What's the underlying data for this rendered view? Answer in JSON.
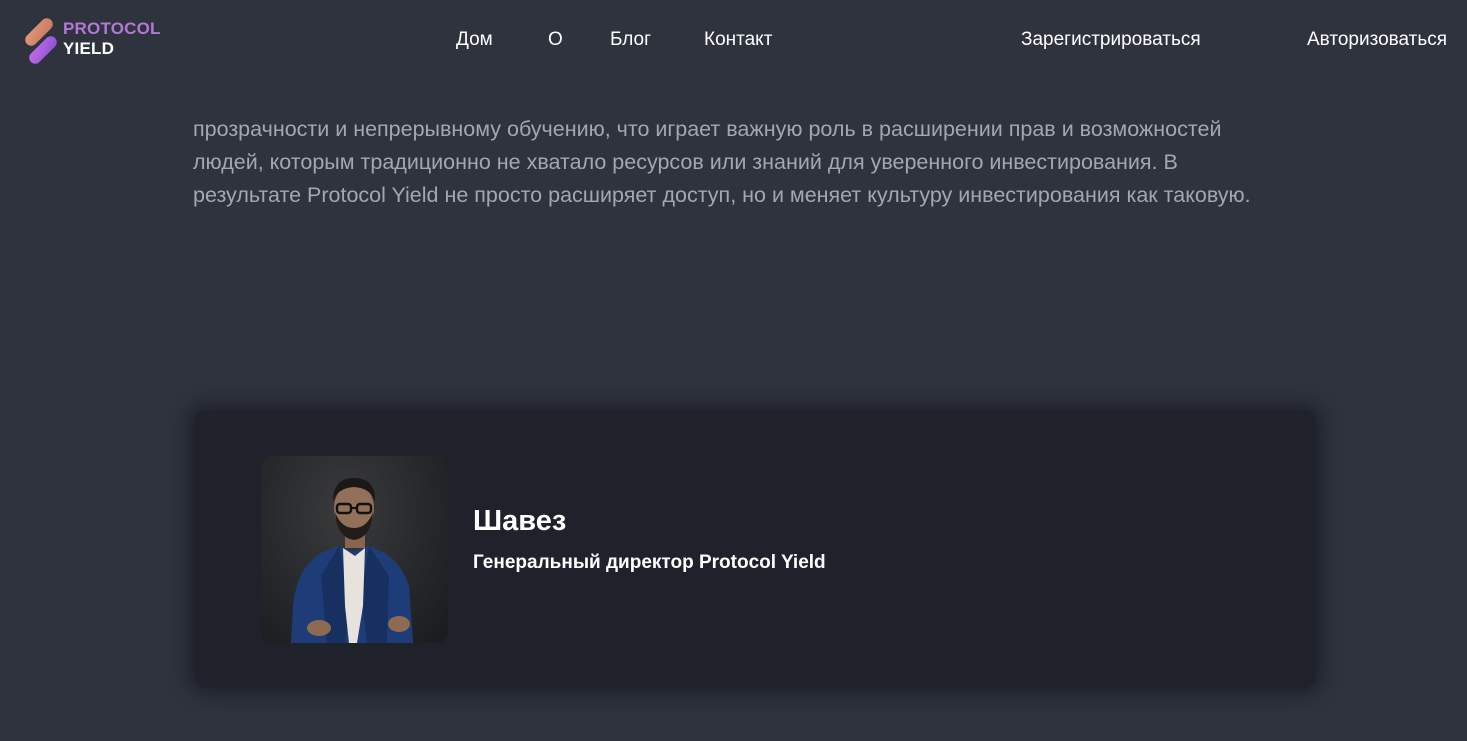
{
  "header": {
    "logo": {
      "line1": "PROTOCOL",
      "line2": "YIELD",
      "colors": {
        "line1": "#b577d6",
        "mark_top": "#d9896f",
        "mark_bottom": "#a35bd9"
      }
    },
    "nav": [
      {
        "label": "Дом"
      },
      {
        "label": "О"
      },
      {
        "label": "Блог"
      },
      {
        "label": "Контакт"
      }
    ],
    "auth": {
      "register_label": "Зарегистрироваться",
      "login_label": "Авторизоваться"
    }
  },
  "main": {
    "intro_text": "прозрачности и непрерывному обучению, что играет важную роль в расширении прав и возможностей людей, которым традиционно не хватало ресурсов или знаний для уверенного инвестирования. В результате Protocol Yield не просто расширяет доступ, но и меняет культуру инвестирования как таковую.",
    "person_card": {
      "avatar_icon": "person-photo",
      "name": "Шавез",
      "role": "Генеральный директор Protocol Yield"
    }
  },
  "colors": {
    "background": "#2e333e",
    "card_background": "#1f222b",
    "muted_text": "#a3a7b0",
    "text": "#ffffff"
  }
}
